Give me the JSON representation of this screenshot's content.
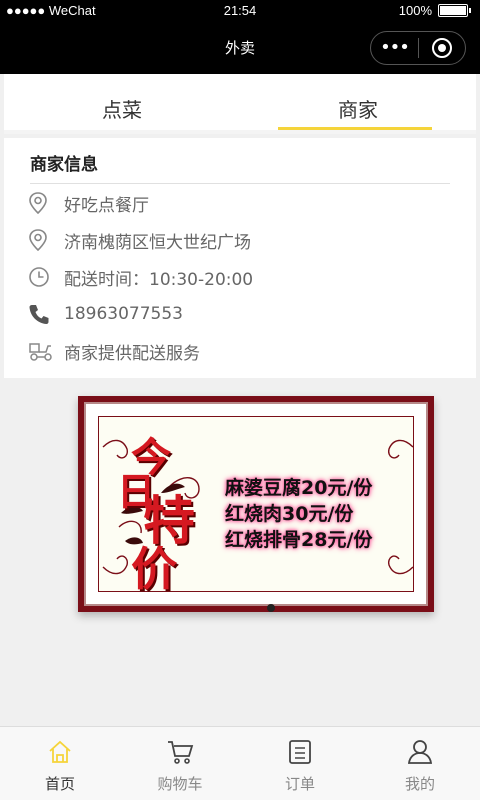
{
  "status_bar": {
    "carrier": "●●●●● WeChat",
    "time": "21:54",
    "battery": "100%"
  },
  "nav": {
    "title": "外卖",
    "more": "•••"
  },
  "tabs": [
    {
      "label": "点菜",
      "active": false
    },
    {
      "label": "商家",
      "active": true
    }
  ],
  "merchant": {
    "title": "商家信息",
    "items": [
      {
        "icon": "location-pin-icon",
        "text": "好吃点餐厅"
      },
      {
        "icon": "location-pin-icon",
        "text": "济南槐荫区恒大世纪广场"
      },
      {
        "icon": "clock-icon",
        "text": "配送时间：10:30-20:00"
      },
      {
        "icon": "phone-icon",
        "text": "18963077553"
      },
      {
        "icon": "delivery-scooter-icon",
        "text": "商家提供配送服务"
      }
    ]
  },
  "banner": {
    "chars": [
      "今",
      "日",
      "特",
      "价"
    ],
    "deals": [
      "麻婆豆腐20元/份",
      "红烧肉30元/份",
      "红烧排骨28元/份"
    ]
  },
  "tab_bar": [
    {
      "label": "首页",
      "icon": "home-icon",
      "active": true
    },
    {
      "label": "购物车",
      "icon": "cart-icon",
      "active": false
    },
    {
      "label": "订单",
      "icon": "order-list-icon",
      "active": false
    },
    {
      "label": "我的",
      "icon": "user-icon",
      "active": false
    }
  ],
  "colors": {
    "accent": "#f5d43a",
    "banner_red": "#d51921"
  }
}
